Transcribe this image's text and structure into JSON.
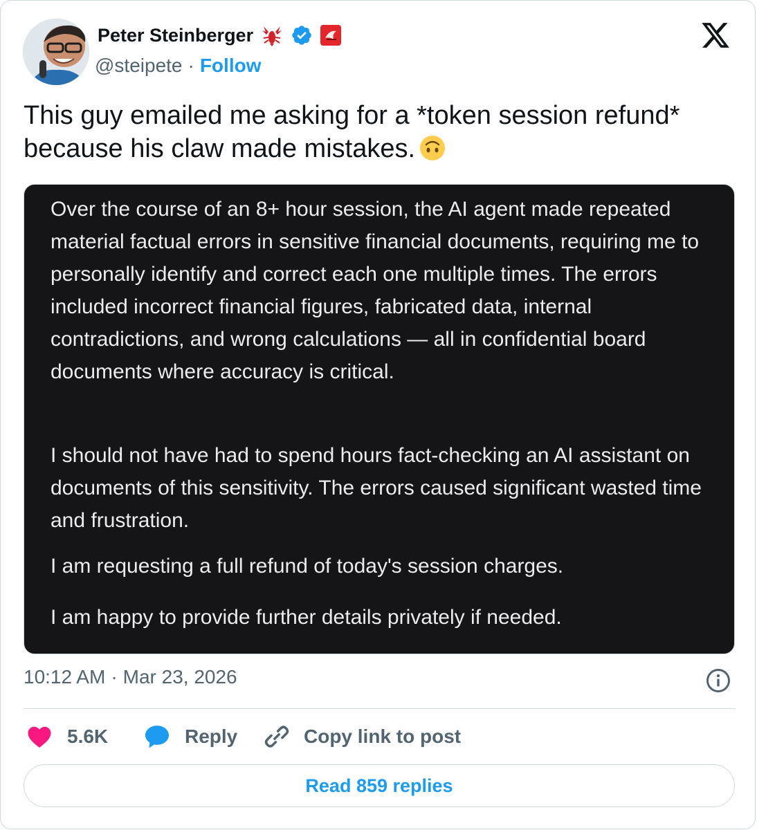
{
  "author": {
    "name": "Peter Steinberger",
    "handle": "@steipete",
    "separator": "·",
    "follow_label": "Follow"
  },
  "tweet": {
    "text": "This guy emailed me asking for a *token session refund* because his claw made mistakes.",
    "emoji": "upside-down-face-emoji"
  },
  "media": {
    "paragraphs": [
      "Over the course of an 8+ hour session, the AI agent made repeated material factual errors in sensitive financial documents, requiring me to personally identify and correct each one multiple times. The errors included incorrect financial figures, fabricated data, internal contradictions, and wrong calculations — all in confidential board documents where accuracy is critical.",
      "I should not have had to spend hours fact-checking an AI assistant on documents of this sensitivity. The errors caused significant wasted time and frustration.",
      "I am requesting a full refund of today's session charges.",
      "I am happy to provide further details privately if needed."
    ]
  },
  "meta": {
    "time": "10:12 AM",
    "separator": "·",
    "date": "Mar 23, 2026"
  },
  "actions": {
    "like_count": "5.6K",
    "reply_label": "Reply",
    "copy_link_label": "Copy link to post"
  },
  "read_replies_label": "Read 859 replies",
  "colors": {
    "accent": "#1d9bf0",
    "like": "#f91880",
    "muted": "#536471",
    "media_bg": "#151518"
  },
  "icons": [
    "lobster-emoji-icon",
    "verified-badge-icon",
    "affiliate-badge-icon",
    "x-logo-icon",
    "info-icon",
    "heart-icon",
    "reply-bubble-icon",
    "link-icon"
  ]
}
